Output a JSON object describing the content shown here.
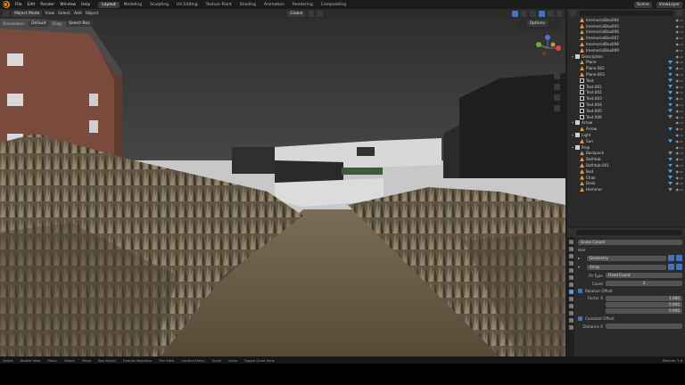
{
  "topbar": {
    "menus": [
      "File",
      "Edit",
      "Render",
      "Window",
      "Help"
    ],
    "workspaces": [
      "Layout",
      "Modeling",
      "Sculpting",
      "UV Editing",
      "Texture Paint",
      "Shading",
      "Animation",
      "Rendering",
      "Compositing"
    ],
    "active_workspace": "Layout",
    "scene": "Scene",
    "view_layer": "ViewLayer"
  },
  "viewport_header": {
    "mode": "Object Mode",
    "menus": [
      "View",
      "Select",
      "Add",
      "Object"
    ],
    "transform": "Global",
    "orientation": "Orientation:",
    "orientation_value": "Default",
    "drag": "Drag:",
    "drag_value": "Select Box",
    "options": "Options"
  },
  "outliner": {
    "search_placeholder": "",
    "rows": [
      {
        "name": "ImemorialBox004",
        "type": "mesh",
        "depth": 2,
        "mod": false
      },
      {
        "name": "ImemorialBox005",
        "type": "mesh",
        "depth": 2,
        "mod": false
      },
      {
        "name": "ImemorialBox006",
        "type": "mesh",
        "depth": 2,
        "mod": false
      },
      {
        "name": "ImemorialBox007",
        "type": "mesh",
        "depth": 2,
        "mod": false
      },
      {
        "name": "ImemorialBox008",
        "type": "mesh",
        "depth": 2,
        "mod": false
      },
      {
        "name": "ImemorialBox009",
        "type": "mesh",
        "depth": 2,
        "mod": false
      },
      {
        "name": "Description",
        "type": "collection",
        "depth": 1,
        "mod": false
      },
      {
        "name": "Plane",
        "type": "mesh",
        "depth": 2,
        "mod": true
      },
      {
        "name": "Plane.002",
        "type": "mesh",
        "depth": 2,
        "mod": true
      },
      {
        "name": "Plane.003",
        "type": "mesh",
        "depth": 2,
        "mod": true
      },
      {
        "name": "Text",
        "type": "text",
        "depth": 2,
        "mod": true
      },
      {
        "name": "Text.001",
        "type": "text",
        "depth": 2,
        "mod": true
      },
      {
        "name": "Text.002",
        "type": "text",
        "depth": 2,
        "mod": true
      },
      {
        "name": "Text.003",
        "type": "text",
        "depth": 2,
        "mod": true
      },
      {
        "name": "Text.004",
        "type": "text",
        "depth": 2,
        "mod": true
      },
      {
        "name": "Text.005",
        "type": "text",
        "depth": 2,
        "mod": true
      },
      {
        "name": "Text.006",
        "type": "text",
        "depth": 2,
        "mod": true
      },
      {
        "name": "Arrow",
        "type": "collection",
        "depth": 1,
        "mod": false
      },
      {
        "name": "Arrow",
        "type": "mesh",
        "depth": 2,
        "mod": true
      },
      {
        "name": "Light",
        "type": "collection",
        "depth": 1,
        "mod": false
      },
      {
        "name": "Sun",
        "type": "mesh",
        "depth": 2,
        "mod": true
      },
      {
        "name": "Prop",
        "type": "collection",
        "depth": 1,
        "mod": false
      },
      {
        "name": "Backpack",
        "type": "mesh",
        "depth": 2,
        "mod": true
      },
      {
        "name": "Bathtub",
        "type": "mesh",
        "depth": 2,
        "mod": true
      },
      {
        "name": "Bathtub.001",
        "type": "mesh",
        "depth": 2,
        "mod": true
      },
      {
        "name": "Bed",
        "type": "mesh",
        "depth": 2,
        "mod": true
      },
      {
        "name": "Chair",
        "type": "mesh",
        "depth": 2,
        "mod": true
      },
      {
        "name": "Desk",
        "type": "mesh",
        "depth": 2,
        "mod": true
      },
      {
        "name": "Hammer",
        "type": "mesh",
        "depth": 2,
        "mod": true
      }
    ]
  },
  "properties": {
    "object_name": "Grass Carpet",
    "section_hair": "Hair",
    "modifier_1": "Geometry",
    "modifier_2": "Array",
    "fit_type_label": "Fit Type",
    "fit_type_value": "Fixed Count",
    "count_label": "Count",
    "count_value": "3",
    "relative_offset": "Relative Offset",
    "factor_label": "Factor X",
    "offsets": [
      "1.000",
      "0.000",
      "0.000"
    ],
    "constant_offset": "Constant Offset",
    "distance_label": "Distance X"
  },
  "statusbar": {
    "items": [
      "Select",
      "Rotate View",
      "Move",
      "Object",
      "Move",
      "Box Select",
      "Extend Selection",
      "Pan View",
      "Context Menu",
      "Scale",
      "Undo",
      "Toggle Quad View"
    ],
    "version": "Blender 3.6"
  },
  "colors": {
    "accent": "#4772b3",
    "sky": "#3a3a3a",
    "grass": "#6b5f4a"
  }
}
